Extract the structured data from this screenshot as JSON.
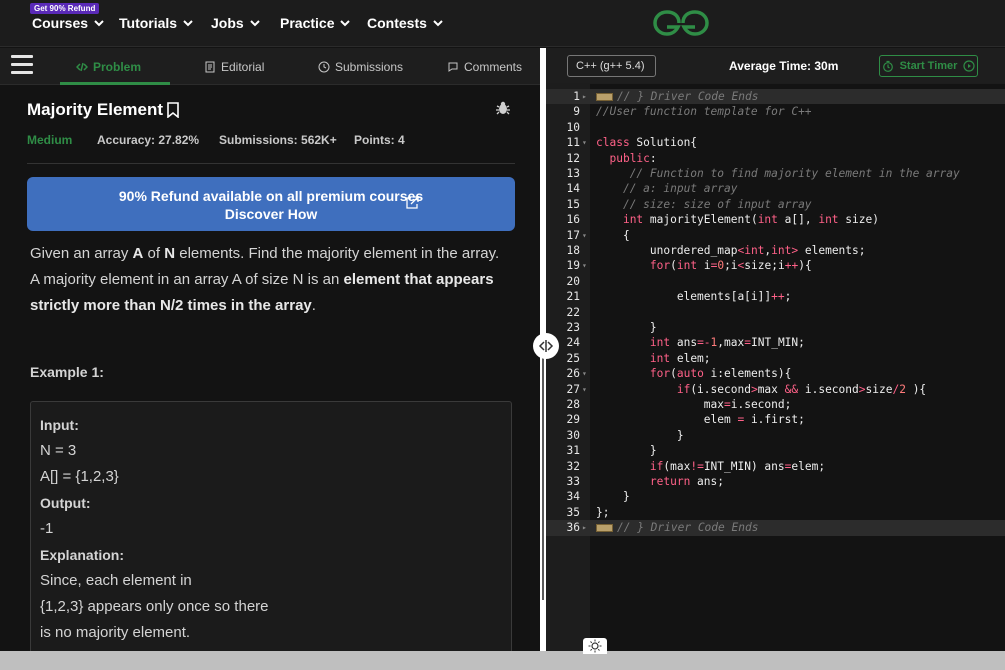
{
  "header": {
    "badge": "Get 90% Refund",
    "nav": [
      "Courses",
      "Tutorials",
      "Jobs",
      "Practice",
      "Contests"
    ]
  },
  "tabs": [
    "Problem",
    "Editorial",
    "Submissions",
    "Comments"
  ],
  "problem": {
    "title": "Majority Element",
    "difficulty": "Medium",
    "accuracy": "Accuracy: 27.82%",
    "submissions": "Submissions: 562K+",
    "points": "Points: 4",
    "banner_line1": "90% Refund available on all premium courses",
    "banner_line2": "Discover How",
    "desc_1": "Given an array ",
    "desc_A": "A",
    "desc_2": " of ",
    "desc_N": "N",
    "desc_3": " elements. Find the majority element in the array. A majority element in an array A of size N is an ",
    "desc_bold": "element that appears strictly more than N/2 times in the array",
    "desc_4": ".",
    "example_heading": "Example 1:",
    "example": {
      "input_label": "Input:",
      "input_1": "N = 3",
      "input_2": "A[] = {1,2,3}",
      "output_label": "Output:",
      "output_val": "-1",
      "explanation_label": "Explanation:",
      "explanation_1": "Since, each element in",
      "explanation_2": "{1,2,3} appears only once so there",
      "explanation_3": "is no majority element."
    }
  },
  "editor": {
    "language": "C++ (g++ 5.4)",
    "avg_time": "Average Time: 30m",
    "timer_label": "Start Timer",
    "lines": [
      {
        "n": "1",
        "fold": "▸",
        "html": "<span class='fold-mark'></span><span class='c-com'>// } Driver Code Ends</span>",
        "hl": true
      },
      {
        "n": "9",
        "fold": "",
        "html": "<span class='c-com'>//User function template for C++</span>"
      },
      {
        "n": "10",
        "fold": "",
        "html": ""
      },
      {
        "n": "11",
        "fold": "▾",
        "html": "<span class='c-kw'>class</span> Solution{"
      },
      {
        "n": "12",
        "fold": "",
        "html": "  <span class='c-kw'>public</span>:"
      },
      {
        "n": "13",
        "fold": "",
        "html": "     <span class='c-com'>// Function to find majority element in the array</span>"
      },
      {
        "n": "14",
        "fold": "",
        "html": "    <span class='c-com'>// a: input array</span>"
      },
      {
        "n": "15",
        "fold": "",
        "html": "    <span class='c-com'>// size: size of input array</span>"
      },
      {
        "n": "16",
        "fold": "",
        "html": "    <span class='c-kw'>int</span> majorityElement(<span class='c-kw'>int</span> a[], <span class='c-kw'>int</span> size)"
      },
      {
        "n": "17",
        "fold": "▾",
        "html": "    {"
      },
      {
        "n": "18",
        "fold": "",
        "html": "        unordered_map<span class='c-op'>&lt;</span><span class='c-kw'>int</span>,<span class='c-kw'>int</span><span class='c-op'>&gt;</span> elements;"
      },
      {
        "n": "19",
        "fold": "▾",
        "html": "        <span class='c-kw'>for</span>(<span class='c-kw'>int</span> i<span class='c-op'>=</span><span class='c-num'>0</span>;i<span class='c-op'>&lt;</span>size;i<span class='c-op'>++</span>){"
      },
      {
        "n": "20",
        "fold": "",
        "html": ""
      },
      {
        "n": "21",
        "fold": "",
        "html": "            elements[a[i]]<span class='c-op'>++</span>;"
      },
      {
        "n": "22",
        "fold": "",
        "html": ""
      },
      {
        "n": "23",
        "fold": "",
        "html": "        }"
      },
      {
        "n": "24",
        "fold": "",
        "html": "        <span class='c-kw'>int</span> ans<span class='c-op'>=-</span><span class='c-num'>1</span>,max<span class='c-op'>=</span>INT_MIN;"
      },
      {
        "n": "25",
        "fold": "",
        "html": "        <span class='c-kw'>int</span> elem;"
      },
      {
        "n": "26",
        "fold": "▾",
        "html": "        <span class='c-kw'>for</span>(<span class='c-kw'>auto</span> i:elements){"
      },
      {
        "n": "27",
        "fold": "▾",
        "html": "            <span class='c-kw'>if</span>(i.second<span class='c-op'>&gt;</span>max <span class='c-op'>&amp;&amp;</span> i.second<span class='c-op'>&gt;</span>size<span class='c-op'>/</span><span class='c-num'>2</span> ){"
      },
      {
        "n": "28",
        "fold": "",
        "html": "                max<span class='c-op'>=</span>i.second;"
      },
      {
        "n": "29",
        "fold": "",
        "html": "                elem <span class='c-op'>=</span> i.first;"
      },
      {
        "n": "30",
        "fold": "",
        "html": "            }"
      },
      {
        "n": "31",
        "fold": "",
        "html": "        }"
      },
      {
        "n": "32",
        "fold": "",
        "html": "        <span class='c-kw'>if</span>(max<span class='c-op'>!=</span>INT_MIN) ans<span class='c-op'>=</span>elem;"
      },
      {
        "n": "33",
        "fold": "",
        "html": "        <span class='c-kw'>return</span> ans;"
      },
      {
        "n": "34",
        "fold": "",
        "html": "    }"
      },
      {
        "n": "35",
        "fold": "",
        "html": "};"
      },
      {
        "n": "36",
        "fold": "▸",
        "html": "<span class='fold-mark'></span><span class='c-com'>// } Driver Code Ends</span>",
        "hl": true
      }
    ]
  },
  "colors": {
    "accent": "#2f8d46",
    "banner": "#3f6fbe",
    "badge": "#5a2ab8"
  }
}
